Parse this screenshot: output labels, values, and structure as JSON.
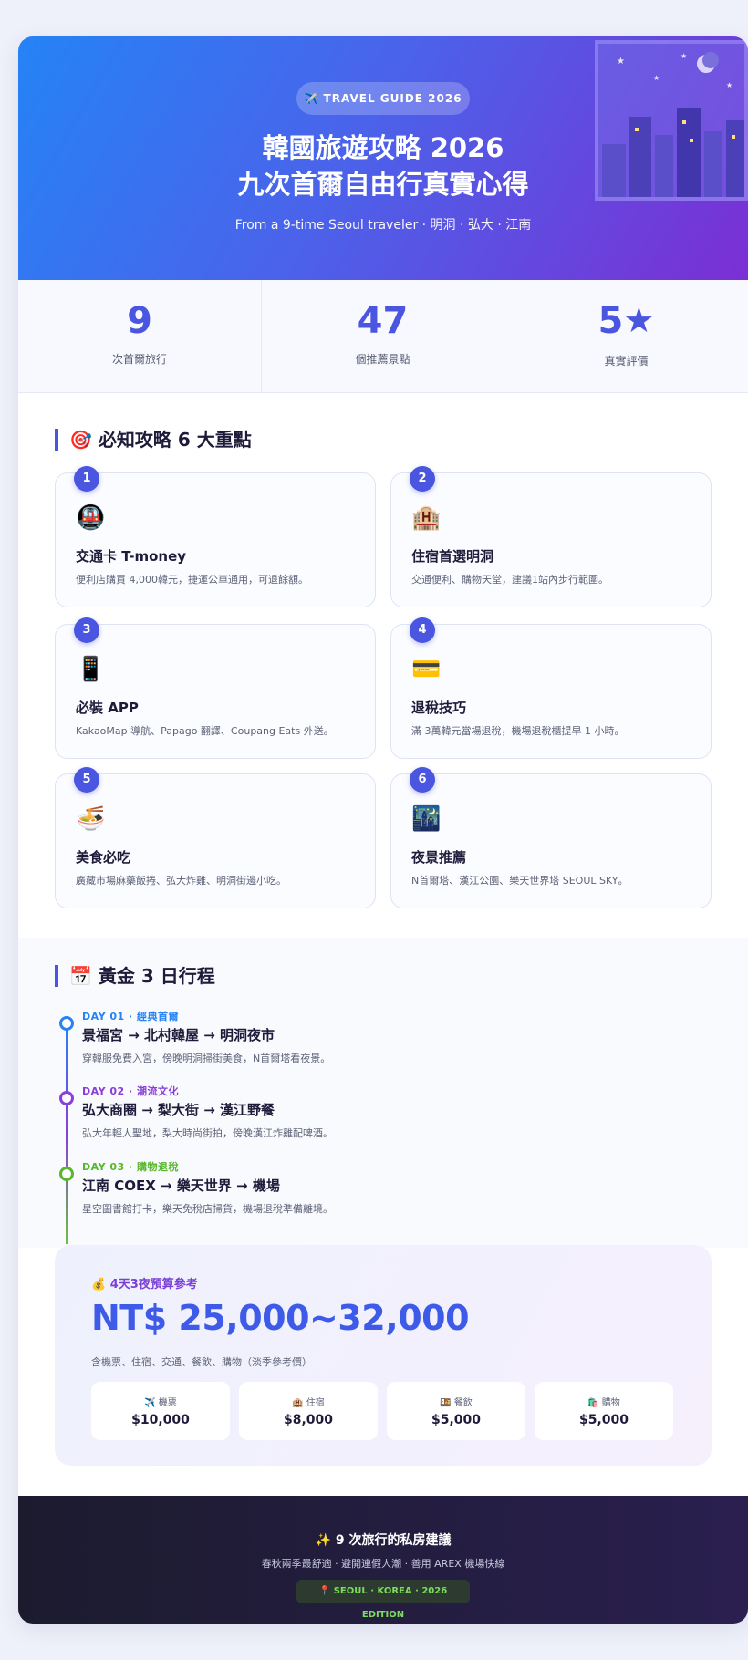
{
  "hero": {
    "badge": "✈️ TRAVEL GUIDE 2026",
    "title_line1": "韓國旅遊攻略 2026",
    "title_line2": "九次首爾自由行真實心得",
    "subtitle": "From a 9-time Seoul traveler · 明洞 · 弘大 · 江南"
  },
  "stats": [
    {
      "value": "9",
      "label": "次首爾旅行"
    },
    {
      "value": "47",
      "label": "個推薦景點"
    },
    {
      "value": "5",
      "label": "真實評價",
      "icon": "star-icon"
    }
  ],
  "tips_section": {
    "icon": "🎯",
    "title": "必知攻略 6 大重點"
  },
  "tips": [
    {
      "num": "1",
      "icon": "🚇",
      "title": "交通卡 T-money",
      "desc": "便利店購買 4,000韓元，捷運公車通用，可退餘額。"
    },
    {
      "num": "2",
      "icon": "🏨",
      "title": "住宿首選明洞",
      "desc": "交通便利、購物天堂，建議1站內步行範圍。"
    },
    {
      "num": "3",
      "icon": "📱",
      "title": "必裝 APP",
      "desc": "KakaoMap 導航、Papago 翻譯、Coupang Eats 外送。"
    },
    {
      "num": "4",
      "icon": "💳",
      "title": "退稅技巧",
      "desc": "滿 3萬韓元當場退稅，機場退稅櫃提早 1 小時。"
    },
    {
      "num": "5",
      "icon": "🍜",
      "title": "美食必吃",
      "desc": "廣藏市場麻藥飯捲、弘大炸雞、明洞街邊小吃。"
    },
    {
      "num": "6",
      "icon": "🌃",
      "title": "夜景推薦",
      "desc": "N首爾塔、漢江公園、樂天世界塔 SEOUL SKY。"
    }
  ],
  "itinerary_section": {
    "icon": "📅",
    "title": "黃金 3 日行程"
  },
  "itinerary": [
    {
      "tag": "DAY 01 · 經典首爾",
      "title": "景福宮 → 北村韓屋 → 明洞夜市",
      "desc": "穿韓服免費入宮，傍晚明洞掃街美食，N首爾塔看夜景。",
      "color": "#2583f6"
    },
    {
      "tag": "DAY 02 · 潮流文化",
      "title": "弘大商圈 → 梨大街 → 漢江野餐",
      "desc": "弘大年輕人聖地，梨大時尚街拍，傍晚漢江炸雞配啤酒。",
      "color": "#8a3fd8"
    },
    {
      "tag": "DAY 03 · 購物退稅",
      "title": "江南 COEX → 樂天世界 → 機場",
      "desc": "星空圖書館打卡，樂天免稅店掃貨，機場退稅準備離境。",
      "color": "#56b82a"
    }
  ],
  "budget": {
    "label": "💰 4天3夜預算參考",
    "amount": "NT$ 25,000~32,000",
    "note": "含機票、住宿、交通、餐飲、購物（淡季參考價）",
    "items": [
      {
        "label": "✈️ 機票",
        "value": "$10,000"
      },
      {
        "label": "🏨 住宿",
        "value": "$8,000"
      },
      {
        "label": "🍱 餐飲",
        "value": "$5,000"
      },
      {
        "label": "🛍️ 購物",
        "value": "$5,000"
      }
    ]
  },
  "footer": {
    "title": "✨ 9 次旅行的私房建議",
    "subtitle": "春秋兩季最舒適 · 避開連假人潮 · 善用 AREX 機場快線",
    "tag": "📍 SEOUL · KOREA · 2026 EDITION"
  }
}
